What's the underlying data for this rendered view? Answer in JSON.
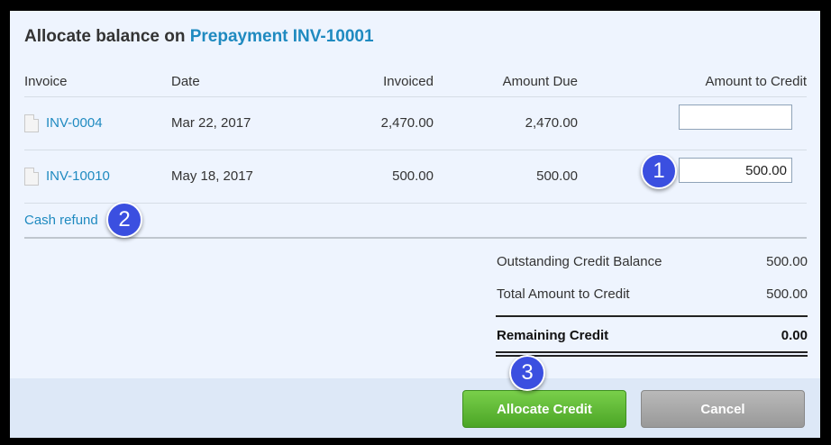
{
  "dialog": {
    "title_prefix": "Allocate balance on",
    "title_link": "Prepayment INV-10001"
  },
  "table": {
    "headers": {
      "invoice": "Invoice",
      "date": "Date",
      "invoiced": "Invoiced",
      "amount_due": "Amount Due",
      "amount_to_credit": "Amount to Credit"
    },
    "rows": [
      {
        "invoice": "INV-0004",
        "date": "Mar 22, 2017",
        "invoiced": "2,470.00",
        "amount_due": "2,470.00",
        "amount_to_credit": ""
      },
      {
        "invoice": "INV-10010",
        "date": "May 18, 2017",
        "invoiced": "500.00",
        "amount_due": "500.00",
        "amount_to_credit": "500.00"
      }
    ]
  },
  "cash_refund_link": "Cash refund",
  "summary": {
    "outstanding_label": "Outstanding Credit Balance",
    "outstanding_value": "500.00",
    "total_label": "Total Amount to Credit",
    "total_value": "500.00",
    "remaining_label": "Remaining Credit",
    "remaining_value": "0.00"
  },
  "badges": [
    "1",
    "2",
    "3"
  ],
  "buttons": {
    "allocate": "Allocate Credit",
    "cancel": "Cancel"
  },
  "colors": {
    "link": "#1f8ac0",
    "badge": "#3b4fe0",
    "allocate_button": "#5cb832",
    "cancel_button": "#a8a8a8"
  }
}
